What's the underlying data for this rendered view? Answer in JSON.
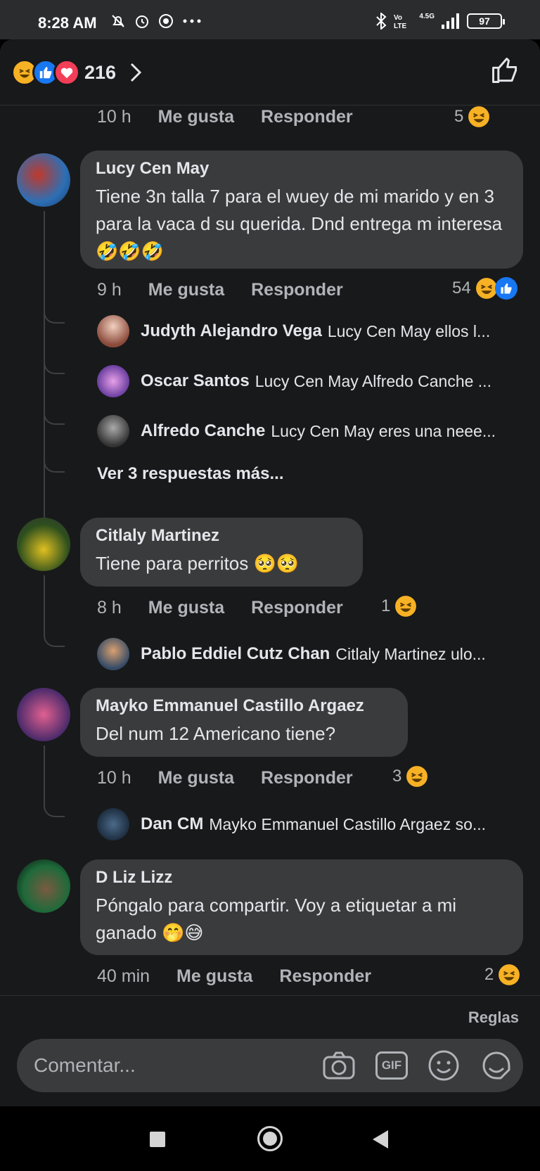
{
  "status_bar": {
    "time": "8:28 AM",
    "battery": "97",
    "network": "4.5G"
  },
  "header": {
    "reaction_count": "216",
    "reactions": [
      "haha-icon",
      "like-icon",
      "love-icon"
    ]
  },
  "top_meta": {
    "time": "10 h",
    "like": "Me gusta",
    "reply": "Responder",
    "reaction_count": "5"
  },
  "comments": [
    {
      "name": "Lucy Cen May",
      "text": "Tiene 3n talla 7 para el wuey de mi marido y en 3 para la vaca d su querida. Dnd entrega m interesa 🤣🤣🤣",
      "time": "9 h",
      "like": "Me gusta",
      "reply": "Responder",
      "reaction_count": "54",
      "replies": [
        {
          "name": "Judyth Alejandro Vega",
          "text": "Lucy Cen May ellos l..."
        },
        {
          "name": "Oscar Santos",
          "text": "Lucy Cen May Alfredo Canche ..."
        },
        {
          "name": "Alfredo Canche",
          "text": "Lucy Cen May eres una neee..."
        }
      ],
      "more_replies": "Ver 3 respuestas más..."
    },
    {
      "name": "Citlaly Martinez",
      "text": "Tiene para perritos 🥺🥺",
      "time": "8 h",
      "like": "Me gusta",
      "reply": "Responder",
      "reaction_count": "1",
      "replies": [
        {
          "name": "Pablo Eddiel Cutz Chan",
          "text": "Citlaly Martinez ulo..."
        }
      ]
    },
    {
      "name": "Mayko Emmanuel Castillo Argaez",
      "text": "Del num 12 Americano tiene?",
      "time": "10 h",
      "like": "Me gusta",
      "reply": "Responder",
      "reaction_count": "3",
      "replies": [
        {
          "name": "Dan CM",
          "text": "Mayko Emmanuel Castillo Argaez so..."
        }
      ]
    },
    {
      "name": "D Liz Lizz",
      "text": "Póngalo para compartir.  Voy a etiquetar a mi ganado 🤭😅",
      "time": "40 min",
      "like": "Me gusta",
      "reply": "Responder",
      "reaction_count": "2"
    }
  ],
  "composer": {
    "rules": "Reglas",
    "placeholder": "Comentar...",
    "icons": [
      "camera-icon",
      "gif-icon",
      "emoji-icon",
      "sticker-icon"
    ],
    "gif_label": "GIF"
  },
  "colors": {
    "background": "#18191a",
    "bubble": "#3a3b3c",
    "text": "#e4e6eb",
    "secondary_text": "#b0b3b8",
    "like_blue": "#1877f2",
    "haha_yellow": "#f7b125",
    "love_red": "#f33e58"
  }
}
